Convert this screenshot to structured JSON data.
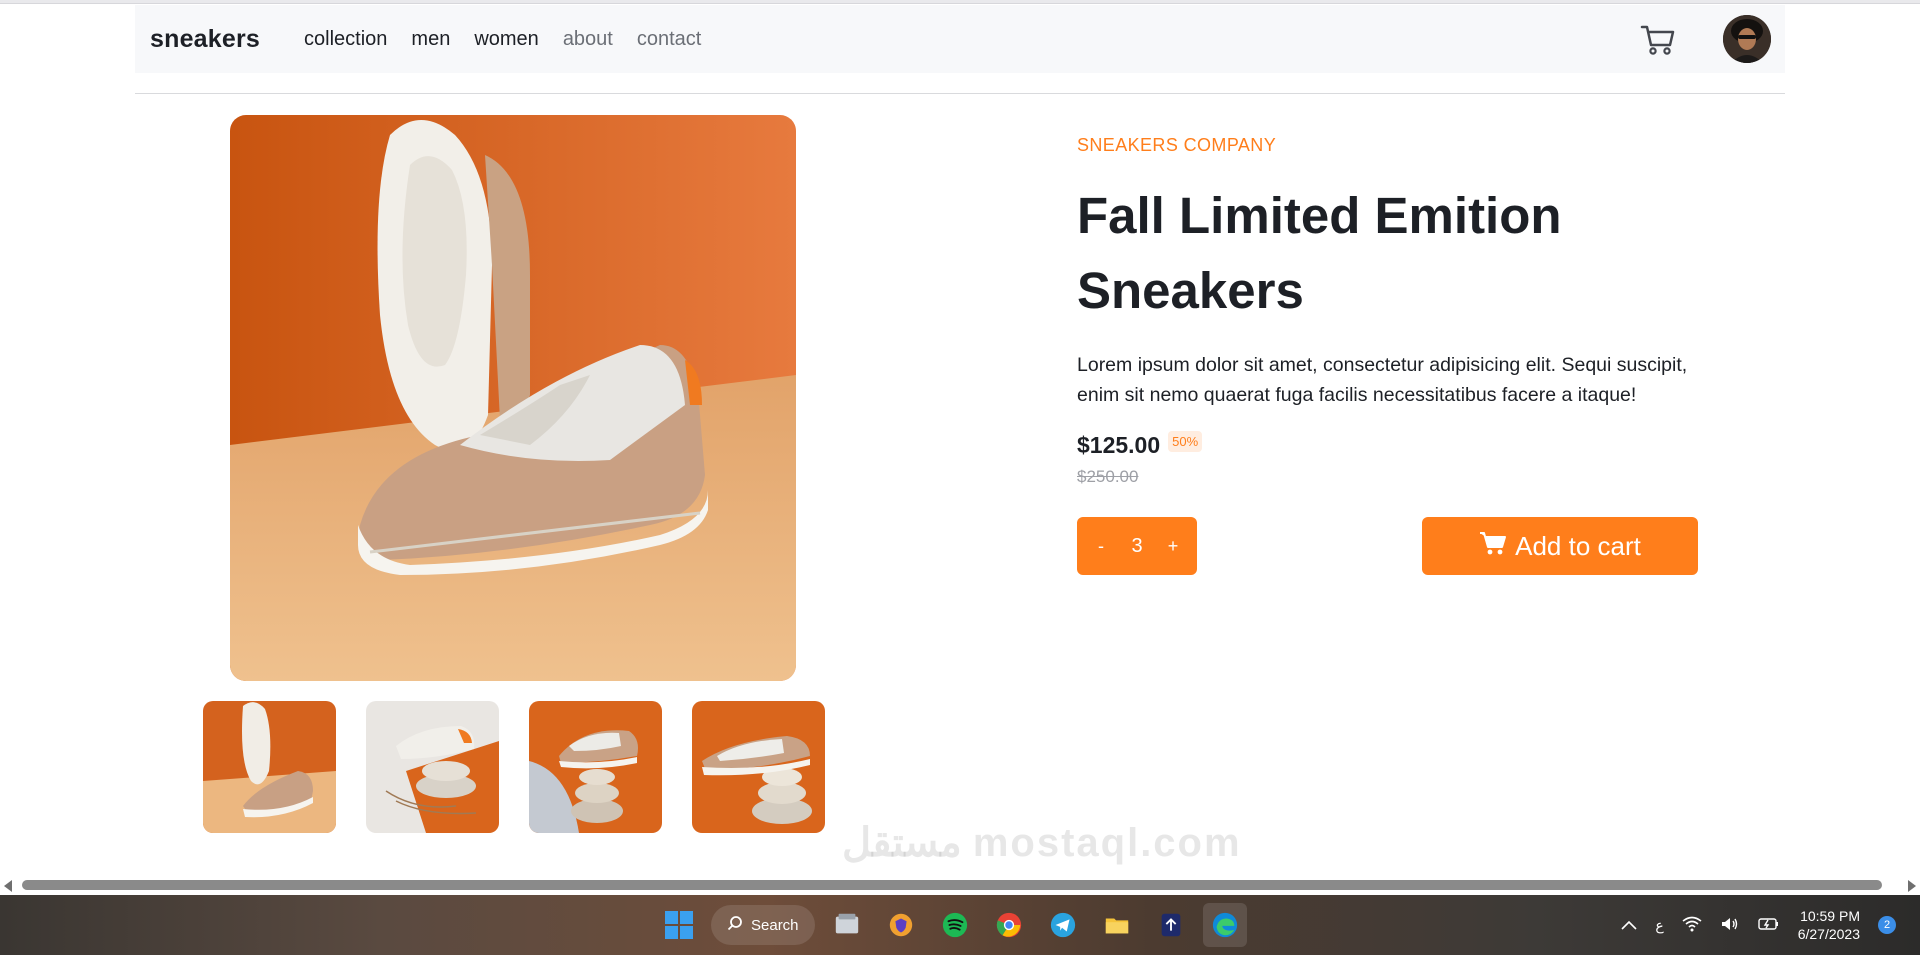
{
  "nav": {
    "logo": "sneakers",
    "links": [
      "collection",
      "men",
      "women",
      "about",
      "contact"
    ]
  },
  "product": {
    "company": "SNEAKERS COMPANY",
    "title_line1": "Fall Limited Emition",
    "title_line2": "Sneakers",
    "description": "Lorem ipsum dolor sit amet, consectetur adipisicing elit. Sequi suscipit, enim sit nemo quaerat fuga facilis necessitatibus facere a itaque!",
    "price": "$125.00",
    "discount": "50%",
    "old_price": "$250.00",
    "quantity": "3",
    "minus_label": "-",
    "plus_label": "+",
    "add_to_cart": "Add to cart"
  },
  "watermark": "مستقل mostaql.com",
  "taskbar": {
    "search_label": "Search",
    "language": "ع",
    "time": "10:59 PM",
    "date": "6/27/2023",
    "notification_count": "2"
  },
  "colors": {
    "accent": "#ff7e1b",
    "accent_light": "#ffede0",
    "text_dark": "#1d2026",
    "text_muted": "#6b6f76"
  }
}
